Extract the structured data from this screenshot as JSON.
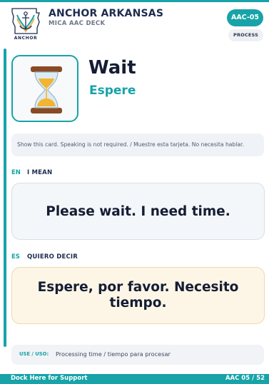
{
  "header": {
    "title": "ANCHOR ARKANSAS",
    "subtitle": "MICA AAC DECK",
    "logo_text": "ANCHOR",
    "card_code": "AAC-05",
    "category": "PROCESS"
  },
  "card": {
    "symbol_icon": "hourglass-icon",
    "word_en": "Wait",
    "word_es": "Espere",
    "instruction": "Show this card. Speaking is not required. / Muestre esta tarjeta. No necesita hablar."
  },
  "english": {
    "lang_code": "EN",
    "label": "I MEAN",
    "phrase": "Please wait. I need time."
  },
  "spanish": {
    "lang_code": "ES",
    "label": "QUIERO DECIR",
    "phrase": "Espere, por favor. Necesito tiempo."
  },
  "usage": {
    "label": "USE / USO:",
    "value": "Processing time / tiempo para procesar"
  },
  "footer": {
    "left_text": "Dock Here for Support",
    "page_indicator": "AAC 05 / 52"
  },
  "colors": {
    "accent": "#17a3a8",
    "navy": "#1e2b50",
    "spanish_bg": "#fdf6e7",
    "english_bg": "#f4f7fa"
  }
}
